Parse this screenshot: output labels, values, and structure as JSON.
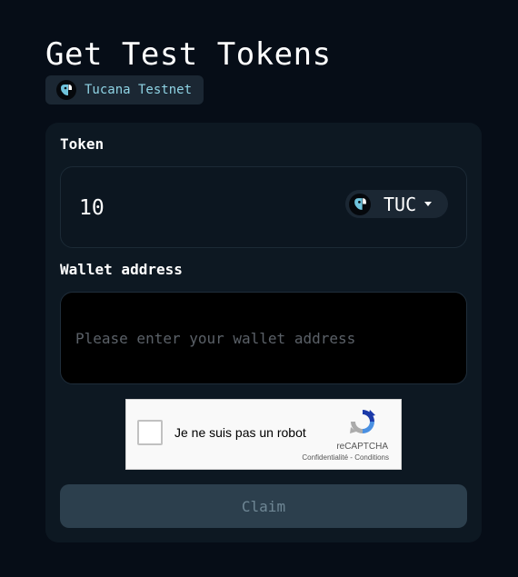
{
  "header": {
    "title": "Get Test Tokens",
    "network": {
      "name": "Tucana Testnet",
      "icon": "tucana-logo-icon"
    }
  },
  "form": {
    "token": {
      "label": "Token",
      "amount": "10",
      "symbol": "TUC",
      "icon": "tucana-logo-icon"
    },
    "wallet": {
      "label": "Wallet address",
      "value": "",
      "placeholder": "Please enter your wallet address"
    },
    "recaptcha": {
      "checkbox_label": "Je ne suis pas un robot",
      "brand": "reCAPTCHA",
      "privacy_link": "Confidentialité",
      "separator": " - ",
      "terms_link": "Conditions",
      "checked": false
    },
    "claim_button": "Claim"
  },
  "colors": {
    "background": "#060d17",
    "card": "#0d1822",
    "badge": "#1b2733",
    "accent_text": "#8fd3e4",
    "button_disabled": "#2c3f4d"
  }
}
